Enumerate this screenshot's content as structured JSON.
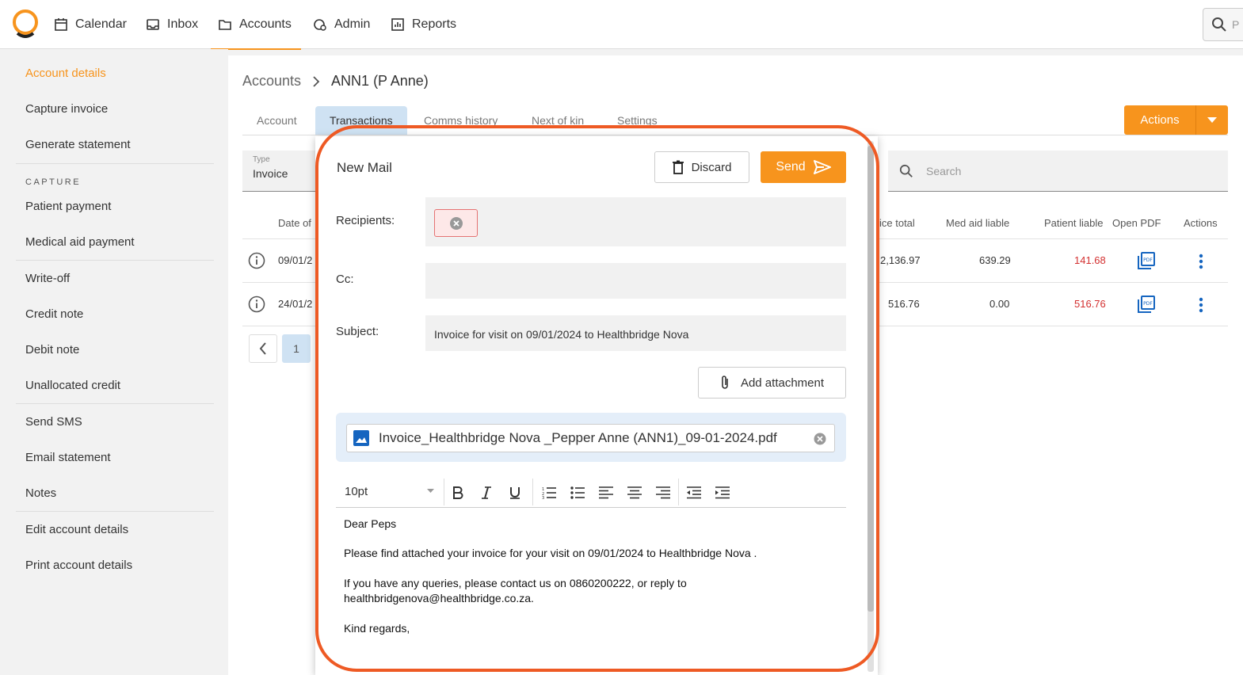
{
  "nav": {
    "items": [
      {
        "label": "Calendar",
        "icon": "calendar-icon"
      },
      {
        "label": "Inbox",
        "icon": "inbox-icon"
      },
      {
        "label": "Accounts",
        "icon": "folder-icon"
      },
      {
        "label": "Admin",
        "icon": "admin-icon"
      },
      {
        "label": "Reports",
        "icon": "reports-icon"
      }
    ],
    "search_hint": "P"
  },
  "sidebar": {
    "account_details": "Account details",
    "capture_invoice": "Capture invoice",
    "generate_statement": "Generate statement",
    "capture_heading": "CAPTURE",
    "patient_payment": "Patient payment",
    "medical_aid_payment": "Medical aid payment",
    "write_off": "Write-off",
    "credit_note": "Credit note",
    "debit_note": "Debit note",
    "unallocated_credit": "Unallocated credit",
    "send_sms": "Send SMS",
    "email_statement": "Email statement",
    "notes": "Notes",
    "edit_account_details": "Edit account details",
    "print_account_details": "Print account details"
  },
  "breadcrumb": {
    "root": "Accounts",
    "current": "ANN1 (P Anne)"
  },
  "tabs": {
    "account": "Account",
    "transactions": "Transactions",
    "comms": "Comms history",
    "kin": "Next of kin",
    "settings": "Settings"
  },
  "actions_label": "Actions",
  "filter": {
    "type_label": "Type",
    "type_value": "Invoice",
    "search_placeholder": "Search"
  },
  "table": {
    "headers": {
      "date": "Date of",
      "invoice_total": "ice total",
      "med_aid": "Med aid liable",
      "patient": "Patient liable",
      "pdf": "Open PDF",
      "actions": "Actions"
    },
    "rows": [
      {
        "date": "09/01/2",
        "invoice_total": "2,136.97",
        "med_aid": "639.29",
        "patient": "141.68"
      },
      {
        "date": "24/01/2",
        "invoice_total": "516.76",
        "med_aid": "0.00",
        "patient": "516.76"
      }
    ]
  },
  "pager": {
    "page": "1"
  },
  "mail": {
    "title": "New Mail",
    "discard_label": "Discard",
    "send_label": "Send",
    "recipients_label": "Recipients:",
    "cc_label": "Cc:",
    "subject_label": "Subject:",
    "subject_value": "Invoice for visit on 09/01/2024 to Healthbridge Nova",
    "add_attachment_label": "Add attachment",
    "attachment_name": "Invoice_Healthbridge Nova _Pepper Anne (ANN1)_09-01-2024.pdf",
    "font_size": "10pt",
    "body": {
      "greeting": "Dear Peps",
      "line1": "Please find attached your invoice for your visit on 09/01/2024 to Healthbridge Nova .",
      "line2": "If you have any queries, please contact us on 0860200222, or reply to",
      "line3": "healthbridgenova@healthbridge.co.za.",
      "closing": "Kind regards,"
    }
  },
  "colors": {
    "accent": "#f7941d",
    "highlight": "#ee5a24",
    "tab_active": "#cfe2f3",
    "red": "#d32f2f",
    "pdf_blue": "#1565c0"
  }
}
